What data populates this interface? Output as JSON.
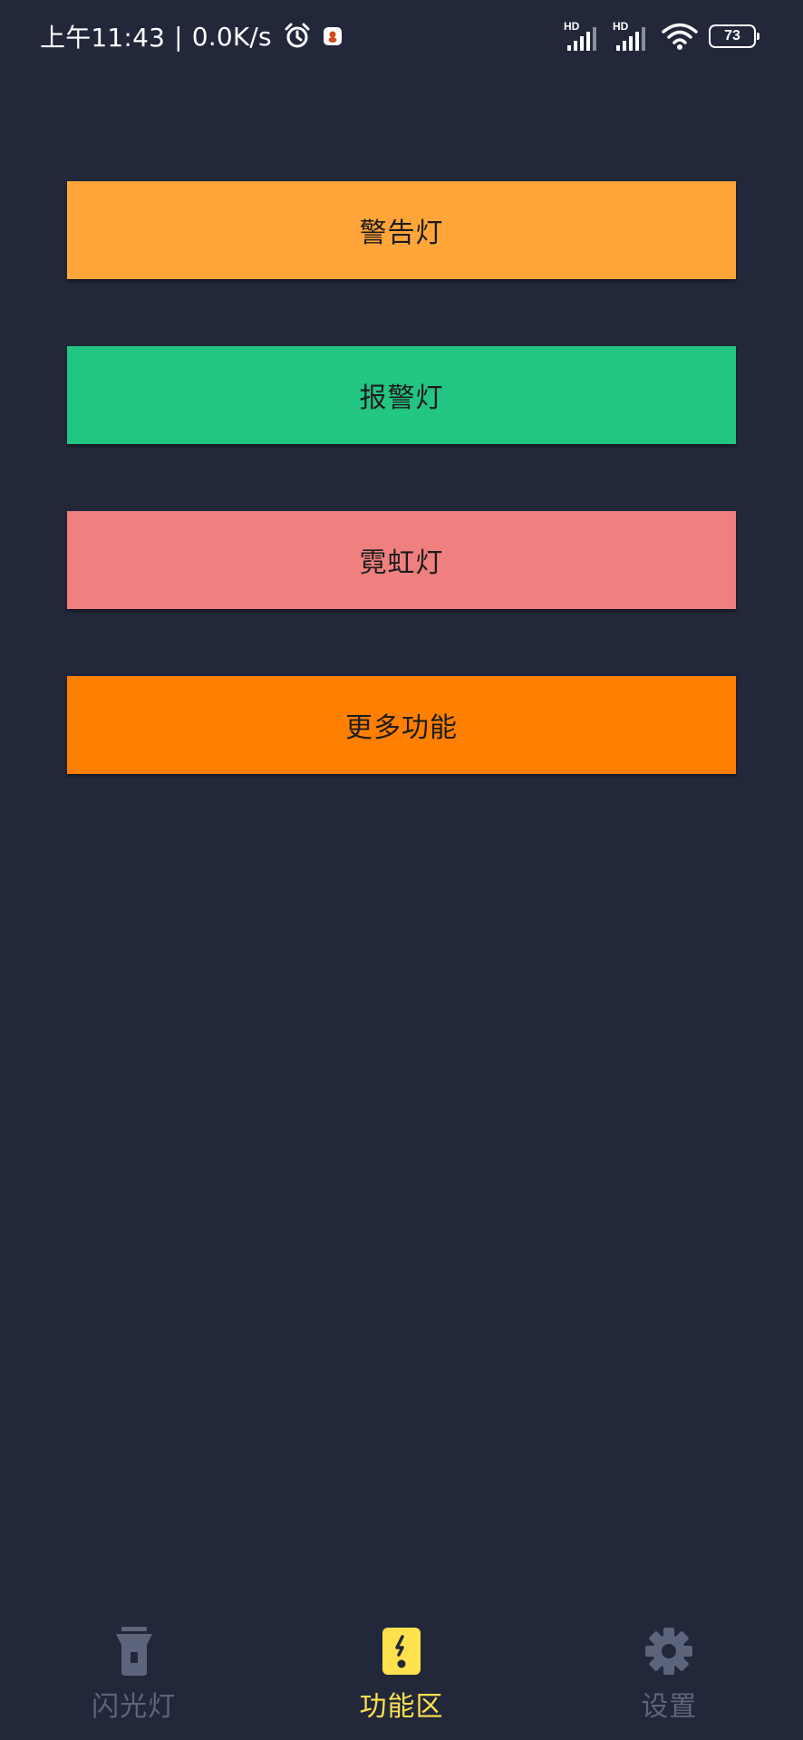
{
  "status_bar": {
    "time": "上午11:43",
    "separator": "|",
    "net_speed": "0.0K/s",
    "alarm_icon": "alarm-clock-icon",
    "notif_icon": "app-notification-icon",
    "signal_label_1": "HD",
    "signal_label_2": "HD",
    "wifi_icon": "wifi-icon",
    "battery": "73"
  },
  "buttons": [
    {
      "label": "警告灯",
      "color": "#ffa53a"
    },
    {
      "label": "报警灯",
      "color": "#22c582"
    },
    {
      "label": "霓虹灯",
      "color": "#f08080"
    },
    {
      "label": "更多功能",
      "color": "#ff7f00"
    }
  ],
  "bottom_nav": {
    "items": [
      {
        "label": "闪光灯",
        "icon": "flashlight-icon",
        "active": false
      },
      {
        "label": "功能区",
        "icon": "function-icon",
        "active": true
      },
      {
        "label": "设置",
        "icon": "gear-icon",
        "active": false
      }
    ],
    "active_color": "#ffe14d",
    "inactive_color": "#5c657c"
  }
}
